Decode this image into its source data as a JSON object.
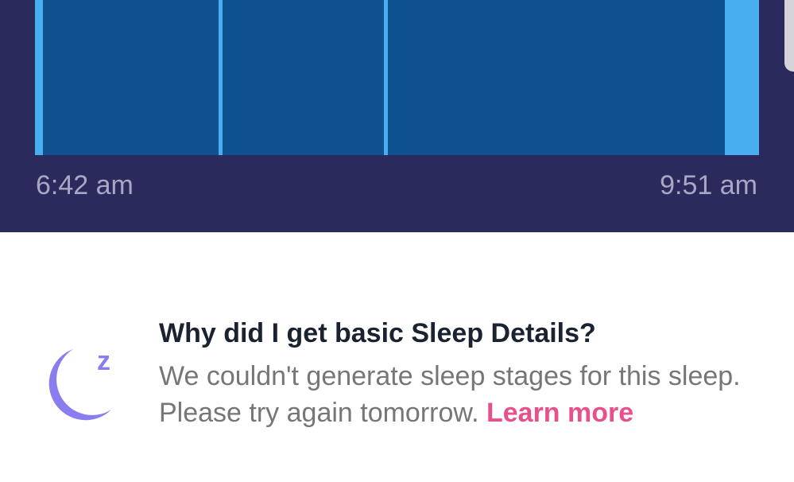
{
  "sleep_chart": {
    "start_time": "6:42 am",
    "end_time": "9:51 am",
    "colors": {
      "background": "#2b2a5c",
      "asleep": "#0e518e",
      "awake": "#49aef0"
    },
    "segments": [
      {
        "state": "awake",
        "fraction": 0.011
      },
      {
        "state": "asleep",
        "fraction": 0.243
      },
      {
        "state": "awake",
        "fraction": 0.005
      },
      {
        "state": "asleep",
        "fraction": 0.223
      },
      {
        "state": "awake",
        "fraction": 0.005
      },
      {
        "state": "asleep",
        "fraction": 0.466
      },
      {
        "state": "awake",
        "fraction": 0.047
      }
    ]
  },
  "info": {
    "icon": "moon-zzz-icon",
    "icon_letter": "z",
    "icon_color": "#8a7df0",
    "title": "Why did I get basic Sleep Details?",
    "body": "We couldn't generate sleep stages for this sleep. Please try again tomorrow.",
    "link_label": "Learn more",
    "link_color": "#e8508c"
  }
}
